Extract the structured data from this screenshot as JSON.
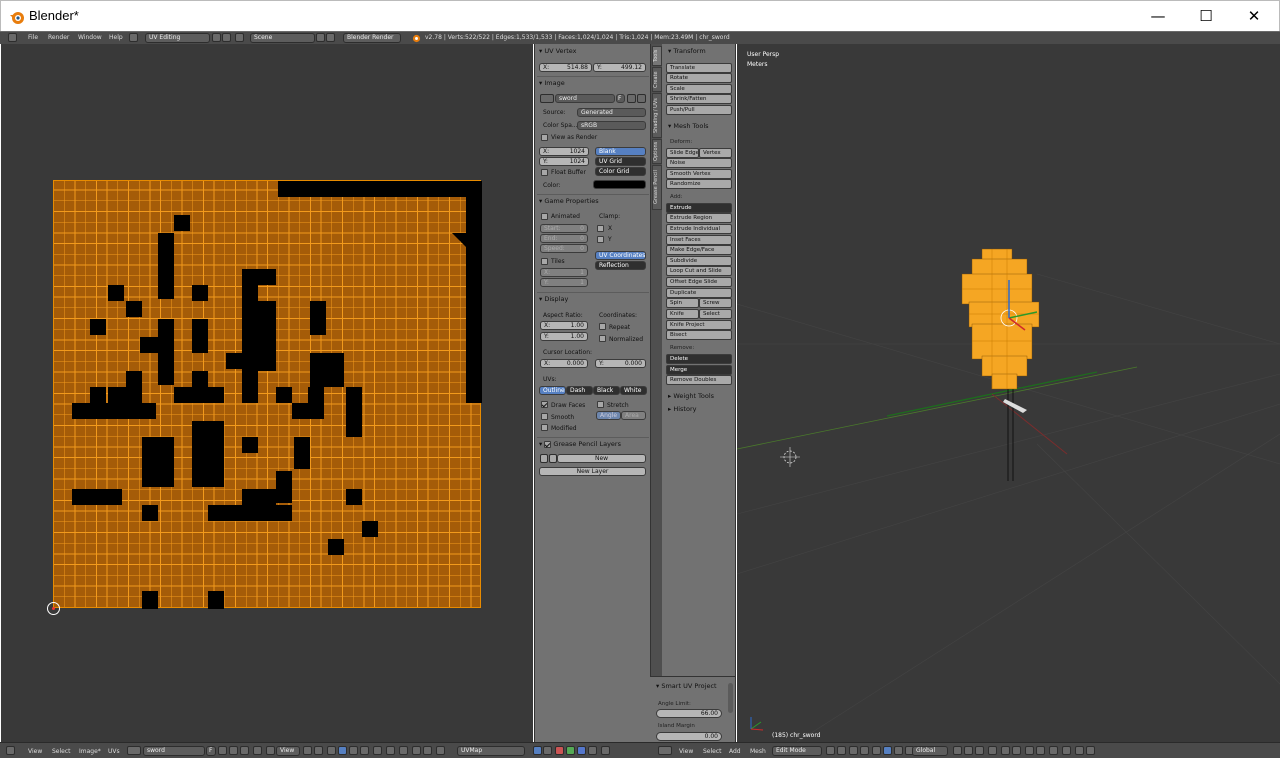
{
  "window": {
    "title": "Blender*",
    "minimize": "—",
    "maximize": "☐",
    "close": "✕"
  },
  "topbar": {
    "menus": [
      "File",
      "Render",
      "Window",
      "Help"
    ],
    "editor_layout": "UV Editing",
    "scene": "Scene",
    "render_engine": "Blender Render",
    "stats": "v2.78 | Verts:522/522 | Edges:1,533/1,533 | Faces:1,024/1,024 | Tris:1,024 | Mem:23.49M | chr_sword"
  },
  "uv_vertex": {
    "header": "UV Vertex",
    "x_label": "X:",
    "x": "514.88",
    "y_label": "Y:",
    "y": "499.12"
  },
  "image": {
    "header": "Image",
    "name": "sword",
    "f_label": "F",
    "source_label": "Source:",
    "source": "Generated",
    "colorspace_label": "Color Spa...",
    "colorspace": "sRGB",
    "view_as_render": "View as Render",
    "x_label": "X:",
    "x": "1024",
    "y_label": "Y:",
    "y": "1024",
    "float_buffer": "Float Buffer",
    "color_label": "Color:",
    "gen_types": [
      "Blank",
      "UV Grid",
      "Color Grid"
    ]
  },
  "game_props": {
    "header": "Game Properties",
    "animated": "Animated",
    "clamp": "Clamp:",
    "start": "Start:",
    "start_val": "0",
    "end": "End:",
    "end_val": "0",
    "speed": "Speed:",
    "speed_val": "0",
    "clamp_x": "X",
    "clamp_y": "Y",
    "tiles": "Tiles",
    "tx": "X:",
    "tx_val": "1",
    "ty": "Y:",
    "ty_val": "1",
    "mapping": [
      "UV Coordinates",
      "Reflection"
    ]
  },
  "display": {
    "header": "Display",
    "aspect": "Aspect Ratio:",
    "coords": "Coordinates:",
    "ax": "X:",
    "ax_val": "1.00",
    "ay": "Y:",
    "ay_val": "1.00",
    "repeat": "Repeat",
    "normalized": "Normalized",
    "cursor": "Cursor Location:",
    "cx": "X:",
    "cx_val": "0.000",
    "cy": "Y:",
    "cy_val": "0.000",
    "uvs": "UVs:",
    "uv_styles": [
      "Outline",
      "Dash",
      "Black",
      "White"
    ],
    "draw_faces": "Draw Faces",
    "stretch": "Stretch",
    "smooth": "Smooth",
    "angle": "Angle",
    "area": "Area",
    "modified": "Modified"
  },
  "grease": {
    "header": "Grease Pencil Layers",
    "new": "New",
    "new_layer": "New Layer"
  },
  "vtabs": [
    "Tools",
    "Create",
    "Shading / UVs",
    "Options",
    "Grease Pencil"
  ],
  "tools": {
    "transform": "Transform",
    "transform_btns": [
      "Translate",
      "Rotate",
      "Scale",
      "Shrink/Fatten",
      "Push/Pull"
    ],
    "mesh_tools": "Mesh Tools",
    "deform": "Deform:",
    "slide_edge": "Slide Edge",
    "vertex": "Vertex",
    "deform_btns": [
      "Noise",
      "Smooth Vertex",
      "Randomize"
    ],
    "add": "Add:",
    "extrude": "Extrude",
    "add_btns": [
      "Extrude Region",
      "Extrude Individual",
      "Inset Faces",
      "Make Edge/Face",
      "Subdivide",
      "Loop Cut and Slide",
      "Offset Edge Slide",
      "Duplicate"
    ],
    "spin": "Spin",
    "screw": "Screw",
    "knife": "Knife",
    "select": "Select",
    "knife_project": "Knife Project",
    "bisect": "Bisect",
    "remove": "Remove:",
    "delete": "Delete",
    "merge": "Merge",
    "remove_doubles": "Remove Doubles",
    "weight_tools": "Weight Tools",
    "history": "History"
  },
  "operator": {
    "header": "Smart UV Project",
    "angle_limit": "Angle Limit:",
    "angle_val": "66.00",
    "island_margin": "Island Margin",
    "margin_val": "0.00"
  },
  "view3d": {
    "persp": "User Persp",
    "units": "Meters",
    "object": "(185) chr_sword"
  },
  "bottombar_left": {
    "menus": [
      "View",
      "Select",
      "Image*",
      "UVs"
    ],
    "image_name": "sword",
    "f": "F",
    "view": "View",
    "uvmap": "UVMap"
  },
  "bottombar_right": {
    "menus": [
      "View",
      "Select",
      "Add",
      "Mesh"
    ],
    "mode": "Edit Mode",
    "orientation": "Global"
  }
}
